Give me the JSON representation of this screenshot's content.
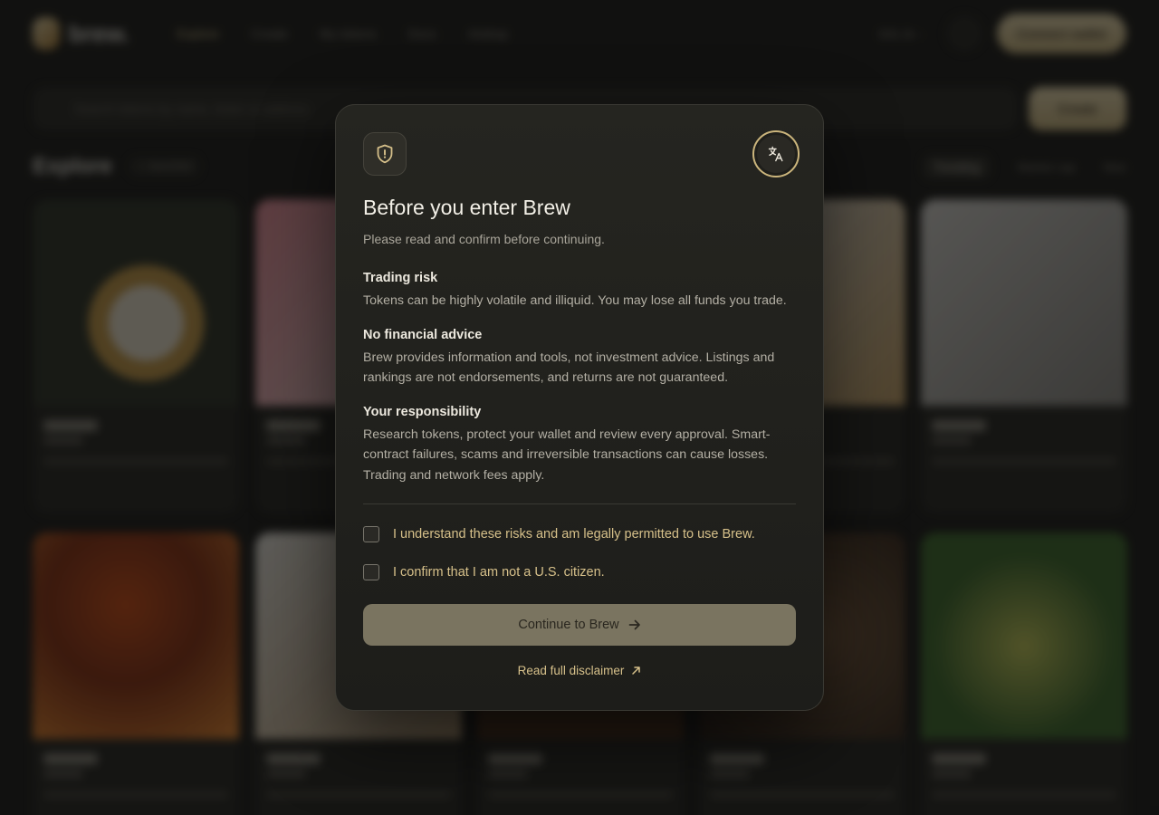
{
  "background": {
    "logo_text": "brew.",
    "nav": [
      "Explore",
      "Create",
      "My tokens",
      "Docs",
      "Airdrop"
    ],
    "sol_price": "SOL $—",
    "connect_label": "Connect wallet",
    "search_placeholder": "Search tokens by name, ticker or address",
    "create_label": "Create",
    "explore_title": "Explore",
    "explore_count": "— launched",
    "sort_tabs": [
      "Trending",
      "Market cap",
      "New"
    ]
  },
  "modal": {
    "title": "Before you enter Brew",
    "subtitle": "Please read and confirm before continuing.",
    "sections": [
      {
        "title": "Trading risk",
        "body": "Tokens can be highly volatile and illiquid. You may lose all funds you trade."
      },
      {
        "title": "No financial advice",
        "body": "Brew provides information and tools, not investment advice. Listings and rankings are not endorsements, and returns are not guaranteed."
      },
      {
        "title": "Your responsibility",
        "body": "Research tokens, protect your wallet and review every approval. Smart-contract failures, scams and irreversible transactions can cause losses. Trading and network fees apply."
      }
    ],
    "checkboxes": [
      {
        "label": "I understand these risks and am legally permitted to use Brew.",
        "checked": false
      },
      {
        "label": "I confirm that I am not a U.S. citizen.",
        "checked": false
      }
    ],
    "continue_label": "Continue to Brew",
    "disclaimer_label": "Read full disclaimer",
    "icons": {
      "header": "shield-alert-icon",
      "language": "translate-icon",
      "continue": "arrow-right-icon",
      "disclaimer": "arrow-up-right-icon"
    },
    "colors": {
      "accent": "#d6c08a",
      "button": "#7a7460",
      "surface": "#22221e"
    }
  }
}
